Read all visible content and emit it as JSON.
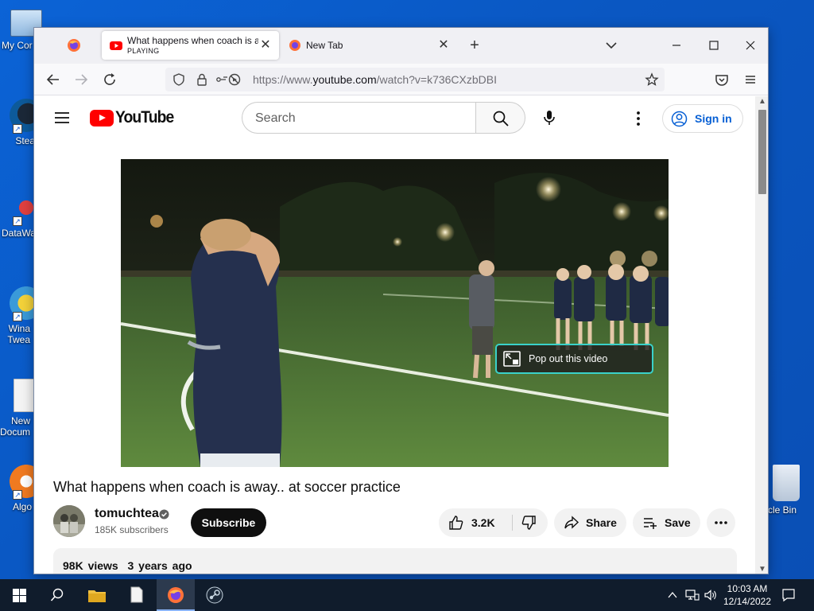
{
  "desktop": {
    "icons": [
      {
        "label": "My Cor",
        "name": "my-computer"
      },
      {
        "label": "Stea",
        "name": "steam"
      },
      {
        "label": "DataWa",
        "name": "datawarrior"
      },
      {
        "label": "Wina Twea",
        "name": "winaero-tweaker"
      },
      {
        "label": "New Docum",
        "name": "new-document"
      },
      {
        "label": "Algo",
        "name": "algodoo"
      },
      {
        "label": "rcle Bin",
        "name": "recycle-bin"
      }
    ]
  },
  "browser": {
    "tabs": [
      {
        "title": "What happens when coach is away.. at soccer practice",
        "subtitle": "PLAYING",
        "active": true
      },
      {
        "title": "New Tab",
        "active": false
      }
    ],
    "url_prefix": "https://www.",
    "url_domain": "youtube.com",
    "url_path": "/watch?v=k736CXzbDBI"
  },
  "youtube": {
    "logo_text": "YouTube",
    "search_placeholder": "Search",
    "sign_in": "Sign in",
    "popout_label": "Pop out this video",
    "video_title": "What happens when coach is away.. at soccer practice",
    "channel_name": "tomuchtea",
    "subscribers": "185K subscribers",
    "subscribe_label": "Subscribe",
    "likes": "3.2K",
    "share_label": "Share",
    "save_label": "Save",
    "views": "98K views",
    "uploaded": "3 years ago"
  },
  "taskbar": {
    "time": "10:03 AM",
    "date": "12/14/2022"
  },
  "colors": {
    "youtube_red": "#ff0000",
    "link_blue": "#065fd4",
    "popout_border": "#3ad1c9",
    "desktop_blue": "#0a5cc8",
    "taskbar": "#101c2c"
  }
}
